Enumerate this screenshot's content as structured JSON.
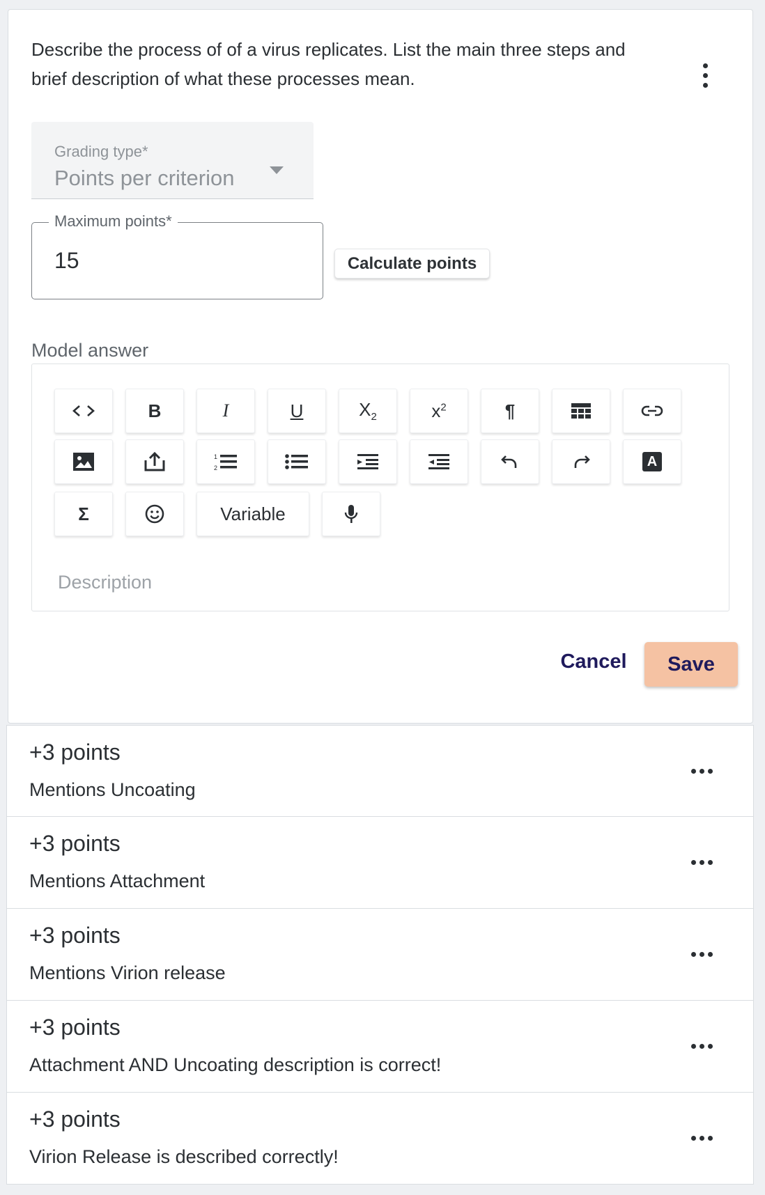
{
  "question": {
    "text": "Describe the process of of a virus replicates. List the main three steps and brief description of what these processes mean."
  },
  "grading": {
    "type_label": "Grading type*",
    "type_value": "Points per criterion",
    "max_points_label": "Maximum points*",
    "max_points_value": "15",
    "calculate_label": "Calculate points"
  },
  "model_answer": {
    "label": "Model answer",
    "placeholder": "Description",
    "toolbar": {
      "row1": [
        {
          "name": "code-view",
          "icon": "code-icon"
        },
        {
          "name": "bold",
          "icon": "bold-icon"
        },
        {
          "name": "italic",
          "icon": "italic-icon"
        },
        {
          "name": "underline",
          "icon": "underline-icon"
        },
        {
          "name": "subscript",
          "icon": "subscript-icon"
        },
        {
          "name": "superscript",
          "icon": "superscript-icon"
        },
        {
          "name": "paragraph",
          "icon": "pilcrow-icon"
        },
        {
          "name": "table",
          "icon": "table-icon"
        },
        {
          "name": "link",
          "icon": "link-icon"
        }
      ],
      "row2": [
        {
          "name": "image",
          "icon": "image-icon"
        },
        {
          "name": "upload",
          "icon": "upload-icon"
        },
        {
          "name": "ordered-list",
          "icon": "ordered-list-icon"
        },
        {
          "name": "bullet-list",
          "icon": "bullet-list-icon"
        },
        {
          "name": "indent",
          "icon": "indent-icon"
        },
        {
          "name": "outdent",
          "icon": "outdent-icon"
        },
        {
          "name": "undo",
          "icon": "undo-icon"
        },
        {
          "name": "redo",
          "icon": "redo-icon"
        },
        {
          "name": "text-color",
          "icon": "text-color-icon"
        }
      ],
      "row3": [
        {
          "name": "formula",
          "icon": "sigma-icon"
        },
        {
          "name": "emoji",
          "icon": "smiley-icon"
        },
        {
          "name": "variable",
          "label": "Variable"
        },
        {
          "name": "voice",
          "icon": "microphone-icon"
        }
      ],
      "glyphs": {
        "bold": "B",
        "italic": "I",
        "underline": "U",
        "subscript_base": "X",
        "subscript_index": "2",
        "superscript_base": "x",
        "superscript_index": "2",
        "paragraph": "¶",
        "text_color": "A",
        "formula": "Σ"
      }
    }
  },
  "actions": {
    "cancel_label": "Cancel",
    "save_label": "Save"
  },
  "criteria": [
    {
      "points": "+3 points",
      "description": "Mentions Uncoating"
    },
    {
      "points": "+3 points",
      "description": "Mentions Attachment"
    },
    {
      "points": "+3 points",
      "description": "Mentions Virion release"
    },
    {
      "points": "+3 points",
      "description": "Attachment AND Uncoating description is correct!"
    },
    {
      "points": "+3 points",
      "description": "Virion Release is described correctly!"
    }
  ],
  "colors": {
    "save_bg": "#f5c2a3",
    "action_text": "#1f1a5c",
    "field_bg": "#f3f4f5"
  }
}
